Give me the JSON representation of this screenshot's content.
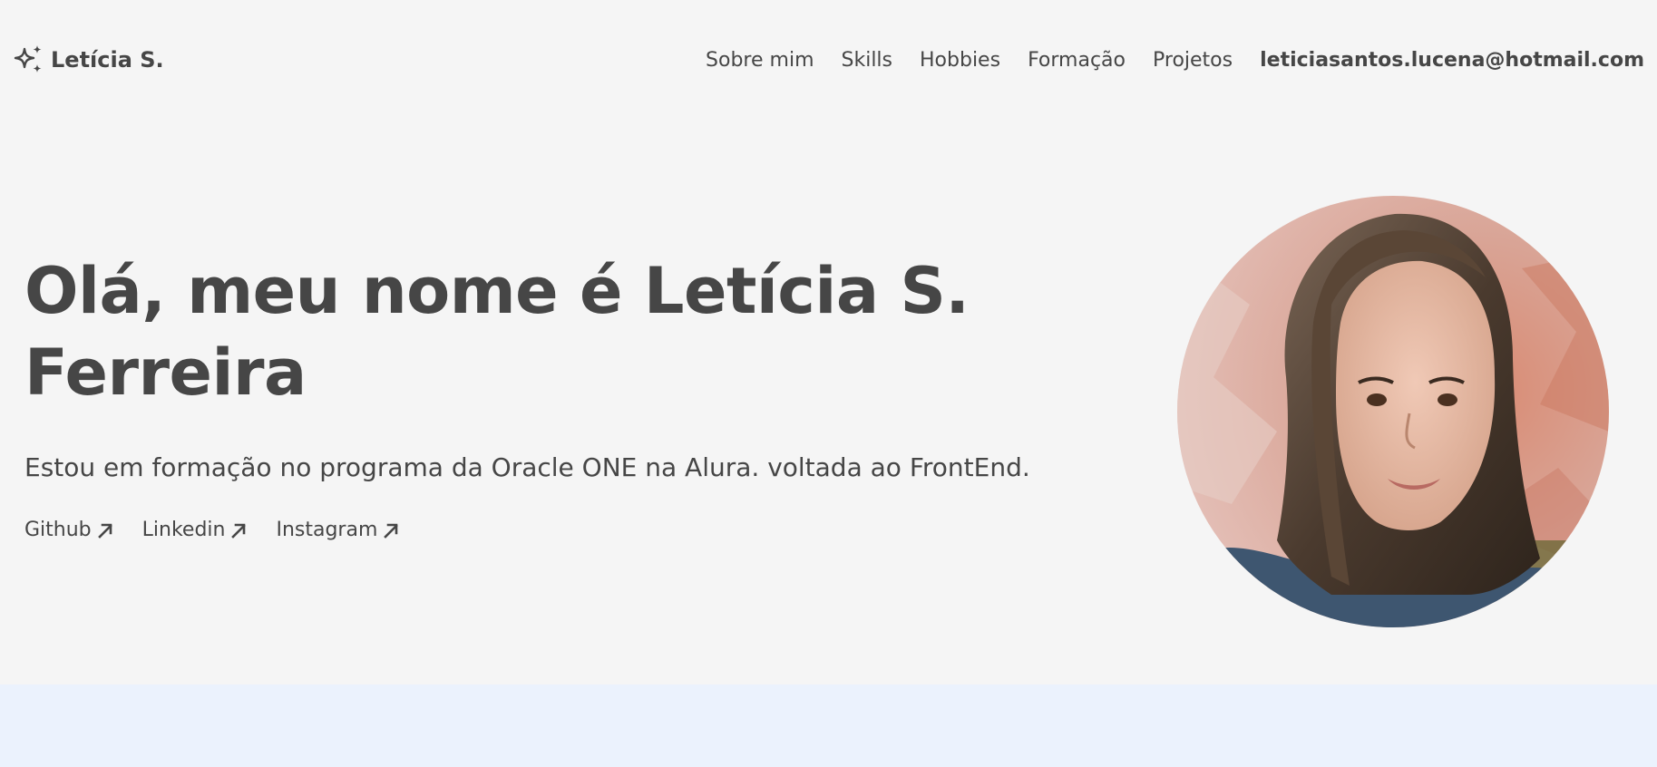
{
  "header": {
    "brand_name": "Letícia S.",
    "brand_icon": "sparkles-icon",
    "nav": [
      {
        "label": "Sobre mim"
      },
      {
        "label": "Skills"
      },
      {
        "label": "Hobbies"
      },
      {
        "label": "Formação"
      },
      {
        "label": "Projetos"
      }
    ],
    "email": "leticiasantos.lucena@hotmail.com"
  },
  "hero": {
    "title_line1": "Olá, meu nome é Letícia S.",
    "title_line2": "Ferreira",
    "subtitle": "Estou em formação no programa da Oracle ONE na Alura. voltada ao FrontEnd.",
    "links": [
      {
        "label": "Github",
        "icon": "arrow-up-right-icon"
      },
      {
        "label": "Linkedin",
        "icon": "arrow-up-right-icon"
      },
      {
        "label": "Instagram",
        "icon": "arrow-up-right-icon"
      }
    ]
  },
  "colors": {
    "background": "#f5f5f5",
    "text": "#464646",
    "next_section": "#ebf2fd"
  }
}
